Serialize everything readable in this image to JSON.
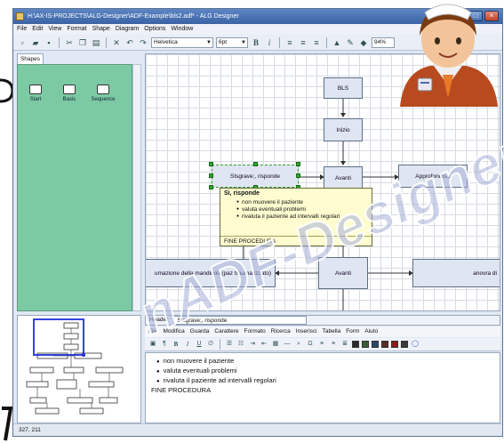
{
  "window": {
    "title": "H:\\AX-IS-PROJECTS\\ALG-Designer\\ADF-Example\\bls2.adf* - ALG Designer",
    "controls": [
      "_",
      "□",
      "×"
    ]
  },
  "menubar": [
    "File",
    "Edit",
    "View",
    "Format",
    "Shape",
    "Diagram",
    "Options",
    "Window"
  ],
  "toolbar": {
    "font": "Helvetica",
    "size": "6pt",
    "bold": "B",
    "italic": "i",
    "zoom": "94%"
  },
  "shapes": {
    "tab": "Shapes",
    "items": [
      "Start",
      "Basic",
      "Sequence"
    ]
  },
  "diagram": {
    "nodes": {
      "bls": "BLS",
      "inizio": "Inizio",
      "selected": "SIsgrave;, risponde",
      "avanti1": "Avanti",
      "approfondisci": "Approfondisci",
      "left_long": "umazione della mandibola(paz traumatizzato)",
      "avanti2": "Avanti",
      "right_long": "anovra di"
    }
  },
  "tooltip": {
    "title": "Sì, risponde",
    "items": [
      "non muovere il paziente",
      "valuta eventuali problemi",
      "rivaluta il paziente ad intervalli regolari"
    ],
    "footer": "FINE PROCEDURA"
  },
  "editor": {
    "header_label": "Header",
    "header_value": "Sìsgrave;, risponde",
    "menu": [
      "File",
      "Modifica",
      "Guarda",
      "Carattere",
      "Formato",
      "Ricerca",
      "Inserisci",
      "Tabella",
      "Form",
      "Aiuto"
    ],
    "tools": [
      "B",
      "I",
      "U"
    ],
    "body": {
      "items": [
        "non muovere il paziente",
        "valuta eventuali problemi",
        "rivaluta il paziente ad intervalli regolari"
      ],
      "footer": "FINE PROCEDURA"
    }
  },
  "status": "327, 211",
  "watermark": "nADF-Designer",
  "colors": {
    "shapes_panel": "#7ccaa4",
    "node_fill": "#dfe6f1",
    "tooltip_bg": "#fffdd0",
    "selection": "#2ea52e",
    "overview_viewport": "#1f2fd6"
  }
}
